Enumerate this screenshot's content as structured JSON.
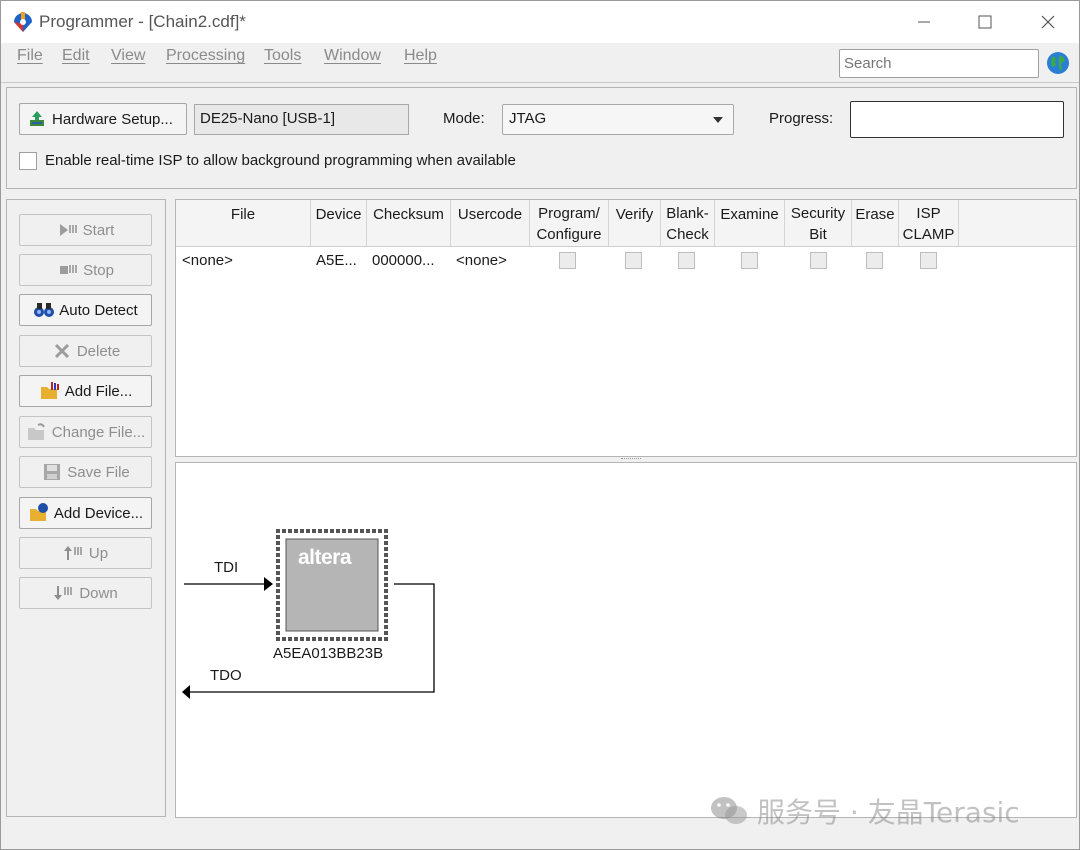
{
  "window": {
    "title": "Programmer - [Chain2.cdf]*"
  },
  "menu": [
    "File",
    "Edit",
    "View",
    "Processing",
    "Tools",
    "Window",
    "Help"
  ],
  "search": {
    "placeholder": "Search"
  },
  "hardware": {
    "setup_label": "Hardware Setup...",
    "device_value": "DE25-Nano [USB-1]",
    "mode_label": "Mode:",
    "mode_value": "JTAG",
    "progress_label": "Progress:",
    "isp_checkbox_label": "Enable real-time ISP to allow background programming when available"
  },
  "sidebar": {
    "start": "Start",
    "stop": "Stop",
    "auto_detect": "Auto Detect",
    "delete": "Delete",
    "add_file": "Add File...",
    "change_file": "Change File...",
    "save_file": "Save File",
    "add_device": "Add Device...",
    "up": "Up",
    "down": "Down"
  },
  "table": {
    "headers": {
      "file": "File",
      "device": "Device",
      "checksum": "Checksum",
      "usercode": "Usercode",
      "program_1": "Program/",
      "program_2": "Configure",
      "verify": "Verify",
      "blank_1": "Blank-",
      "blank_2": "Check",
      "examine": "Examine",
      "security_1": "Security",
      "security_2": "Bit",
      "erase": "Erase",
      "isp_1": "ISP",
      "isp_2": "CLAMP"
    },
    "row": {
      "file": "<none>",
      "device": "A5E...",
      "checksum": "000000...",
      "usercode": "<none>"
    }
  },
  "chain": {
    "tdi": "TDI",
    "tdo": "TDO",
    "chip_brand": "altera",
    "chip_name": "A5EA013BB23B"
  },
  "watermark": "服务号 · 友晶Terasic"
}
